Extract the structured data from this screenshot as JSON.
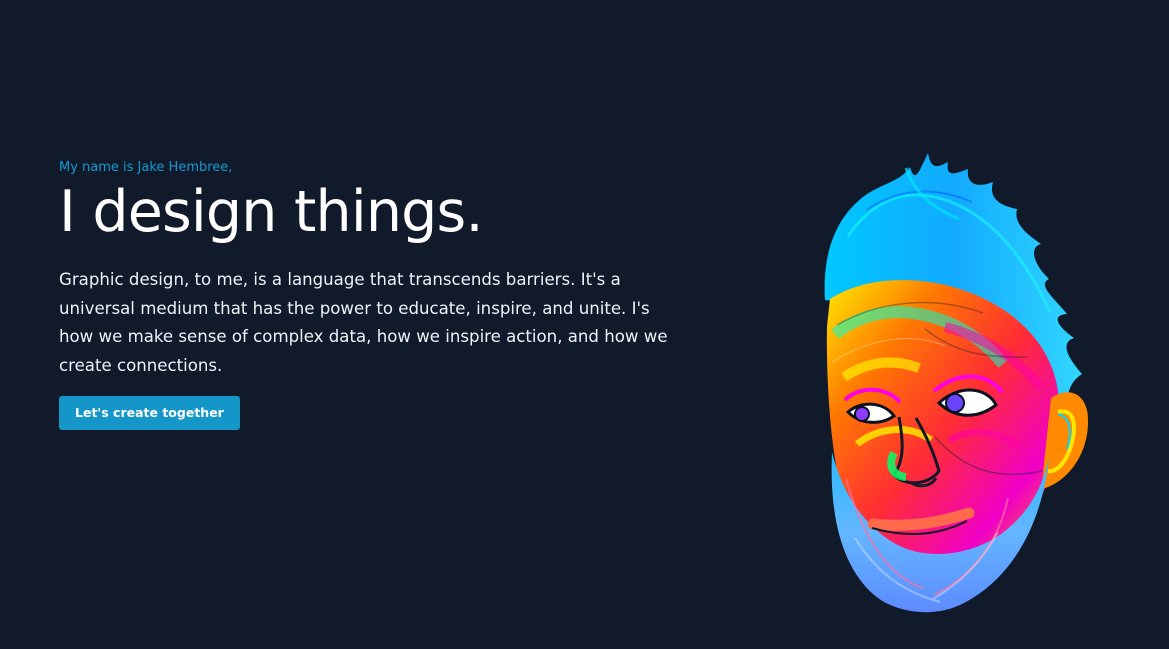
{
  "hero": {
    "eyebrow": "My name is Jake Hembree,",
    "headline": "I design things.",
    "body": "Graphic design, to me, is a language that transcends barriers. It's a universal medium that has the power to educate, inspire, and unite. I's how we make sense of complex data, how we inspire action, and how we create connections.",
    "cta_label": "Let's create together"
  },
  "portrait": {
    "icon": "colorful-face-portrait-illustration"
  },
  "colors": {
    "background": "#111a2b",
    "accent": "#1497c8",
    "eyebrow": "#139ad1",
    "text": "#ffffff"
  }
}
